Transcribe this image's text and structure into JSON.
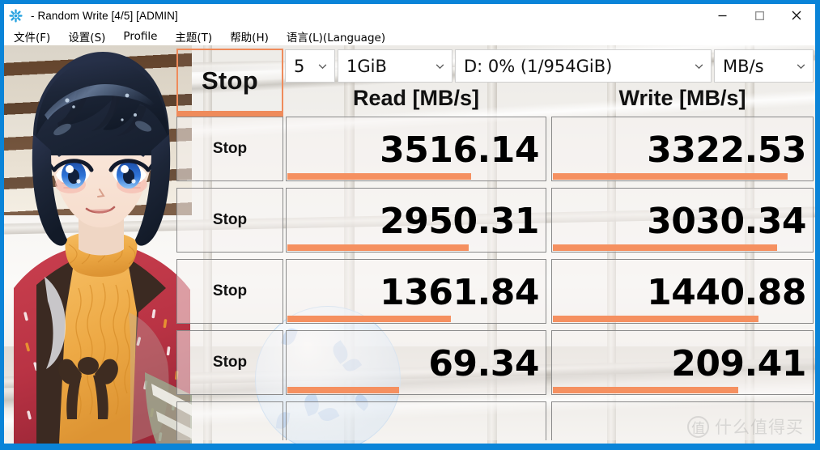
{
  "window": {
    "title": "- Random Write [4/5] [ADMIN]",
    "app_icon": "snowflake-icon",
    "accent_color": "#0a84d8",
    "controls": {
      "minimize": "minimize-icon",
      "maximize": "maximize-icon",
      "close": "close-icon"
    }
  },
  "menubar": {
    "items": [
      {
        "label": "文件(F)"
      },
      {
        "label": "设置(S)"
      },
      {
        "label": "Profile"
      },
      {
        "label": "主题(T)"
      },
      {
        "label": "帮助(H)"
      },
      {
        "label": "语言(L)(Language)"
      }
    ]
  },
  "toolbar": {
    "all_button_label": "Stop",
    "combos": [
      {
        "name": "test-count",
        "value": "5",
        "icon": "chevron-down-icon"
      },
      {
        "name": "test-size",
        "value": "1GiB",
        "icon": "chevron-down-icon"
      },
      {
        "name": "target-drive",
        "value": "D: 0% (1/954GiB)",
        "icon": "chevron-down-icon"
      },
      {
        "name": "unit",
        "value": "MB/s",
        "icon": "chevron-down-icon"
      }
    ]
  },
  "results": {
    "accent_color": "#f59060",
    "headers": {
      "read": "Read [MB/s]",
      "write": "Write [MB/s]"
    },
    "rows": [
      {
        "button_label": "Stop",
        "read": {
          "value": "3516.14",
          "bar_percent": 71
        },
        "write": {
          "value": "3322.53",
          "bar_percent": 90
        }
      },
      {
        "button_label": "Stop",
        "read": {
          "value": "2950.31",
          "bar_percent": 70
        },
        "write": {
          "value": "3030.34",
          "bar_percent": 86
        }
      },
      {
        "button_label": "Stop",
        "read": {
          "value": "1361.84",
          "bar_percent": 63
        },
        "write": {
          "value": "1440.88",
          "bar_percent": 79
        }
      },
      {
        "button_label": "Stop",
        "read": {
          "value": "69.34",
          "bar_percent": 43
        },
        "write": {
          "value": "209.41",
          "bar_percent": 71
        }
      }
    ]
  },
  "watermark": {
    "mark": "值",
    "text": "什么值得买"
  }
}
